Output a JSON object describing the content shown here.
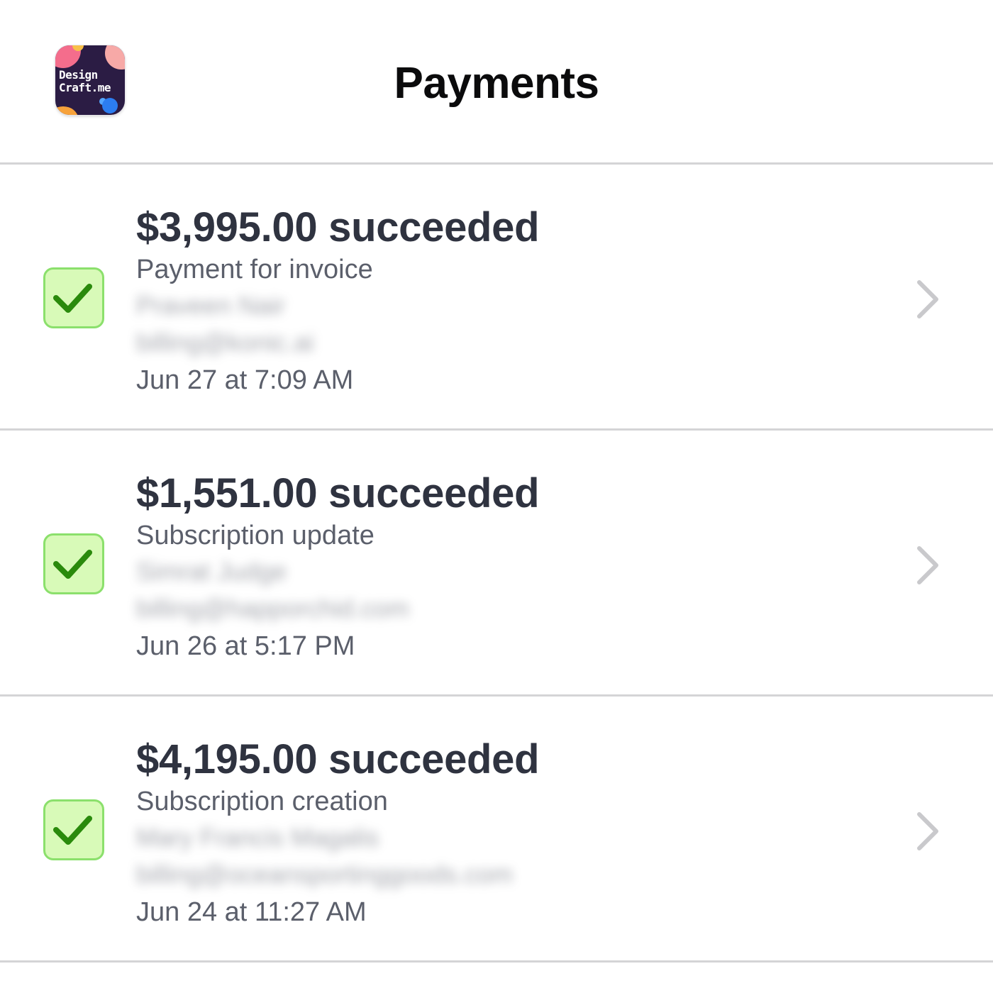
{
  "header": {
    "title": "Payments",
    "app_icon": {
      "line1": "Design",
      "line2": "Craft.me"
    }
  },
  "payments": [
    {
      "amount": "$3,995.00 succeeded",
      "description": "Payment for invoice",
      "customer_name": "Praveen Nair",
      "customer_email": "billing@konic.ai",
      "date": "Jun 27 at 7:09 AM",
      "status_icon": "check-icon",
      "nav_icon": "chevron-right-icon"
    },
    {
      "amount": "$1,551.00 succeeded",
      "description": "Subscription update",
      "customer_name": "Simrat Judge",
      "customer_email": "billing@happorchid.com",
      "date": "Jun 26 at 5:17 PM",
      "status_icon": "check-icon",
      "nav_icon": "chevron-right-icon"
    },
    {
      "amount": "$4,195.00 succeeded",
      "description": "Subscription creation",
      "customer_name": "Mary Francis Magalis",
      "customer_email": "billing@oceansportinggoods.com",
      "date": "Jun 24 at 11:27 AM",
      "status_icon": "check-icon",
      "nav_icon": "chevron-right-icon"
    }
  ],
  "colors": {
    "check_fill": "#d8fab8",
    "check_border": "#8be06c",
    "check_mark": "#2a8a0c",
    "divider": "#d4d4d6",
    "chevron": "#c9c9cc"
  }
}
